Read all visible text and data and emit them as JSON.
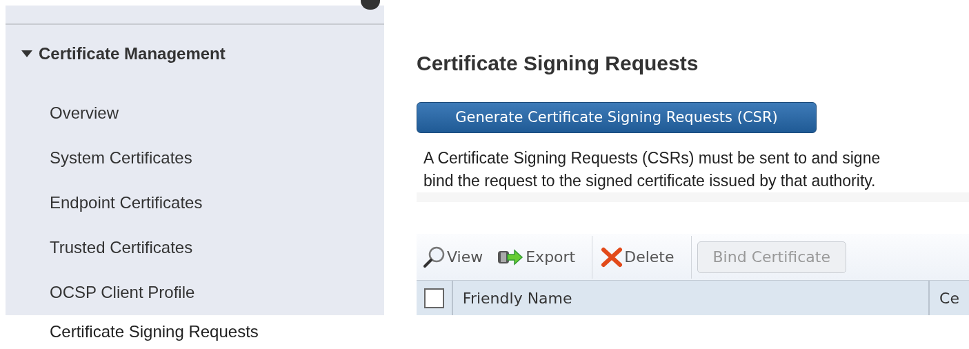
{
  "sidebar": {
    "section": {
      "label": "Certificate Management",
      "expanded": true
    },
    "items": [
      {
        "label": "Overview",
        "selected": false
      },
      {
        "label": "System Certificates",
        "selected": false
      },
      {
        "label": "Endpoint Certificates",
        "selected": false
      },
      {
        "label": "Trusted Certificates",
        "selected": false
      },
      {
        "label": "OCSP Client Profile",
        "selected": false
      },
      {
        "label": "Certificate Signing Requests",
        "selected": true
      }
    ]
  },
  "main": {
    "title": "Certificate Signing Requests",
    "generate_button": "Generate Certificate Signing Requests (CSR)",
    "description": [
      "A Certificate Signing Requests (CSRs) must be sent to and signe",
      "bind the request to the signed certificate issued by that authority."
    ],
    "toolbar": [
      {
        "kind": "view",
        "label": "View",
        "disabled": false
      },
      {
        "kind": "export",
        "label": "Export",
        "disabled": false
      },
      {
        "kind": "delete",
        "label": "Delete",
        "disabled": false
      },
      {
        "kind": "bind",
        "label": "Bind Certificate",
        "disabled": true
      }
    ],
    "table": {
      "select_all_checked": false,
      "columns": [
        "Friendly Name",
        "Ce"
      ]
    }
  }
}
